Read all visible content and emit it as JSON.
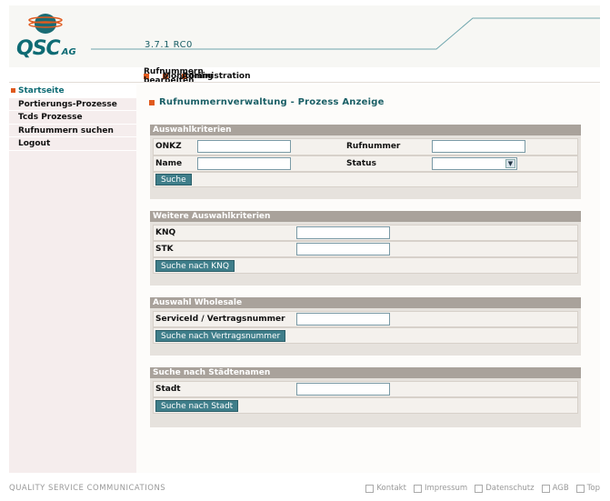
{
  "header": {
    "logo_text": "QSC",
    "logo_suffix": "AG",
    "version": "3.7.1 RC0"
  },
  "topnav": {
    "items": [
      {
        "label": "Rufnummern bearbeiten",
        "active": false
      },
      {
        "label": "Monitoring",
        "active": true
      },
      {
        "label": "Administration",
        "active": false
      }
    ]
  },
  "sidebar": {
    "items": [
      {
        "label": "Startseite"
      },
      {
        "label": "Portierungs-Prozesse"
      },
      {
        "label": "Tcds Prozesse"
      },
      {
        "label": "Rufnummern suchen"
      },
      {
        "label": "Logout"
      }
    ]
  },
  "page": {
    "title": "Rufnummernverwaltung - Prozess Anzeige"
  },
  "panels": {
    "auswahl": {
      "title": "Auswahlkriterien",
      "onkz_label": "ONKZ",
      "onkz_value": "",
      "rufnummer_label": "Rufnummer",
      "rufnummer_value": "",
      "name_label": "Name",
      "name_value": "",
      "status_label": "Status",
      "status_value": "",
      "button": "Suche"
    },
    "weitere": {
      "title": "Weitere Auswahlkriterien",
      "knq_label": "KNQ",
      "knq_value": "",
      "stk_label": "STK",
      "stk_value": "",
      "button": "Suche nach KNQ"
    },
    "wholesale": {
      "title": "Auswahl Wholesale",
      "service_label": "ServiceId / Vertragsnummer",
      "service_value": "",
      "button": "Suche nach Vertragsnummer"
    },
    "stadt": {
      "title": "Suche nach Städtenamen",
      "stadt_label": "Stadt",
      "stadt_value": "",
      "button": "Suche nach Stadt"
    }
  },
  "footer": {
    "company": "QUALITY SERVICE COMMUNICATIONS",
    "links": [
      "Kontakt",
      "Impressum",
      "Datenschutz",
      "AGB",
      "Top"
    ]
  },
  "colors": {
    "brand": "#0e6b74",
    "accent": "#e05a1e",
    "panel_header": "#a9a29b",
    "button": "#3f7e8a"
  }
}
